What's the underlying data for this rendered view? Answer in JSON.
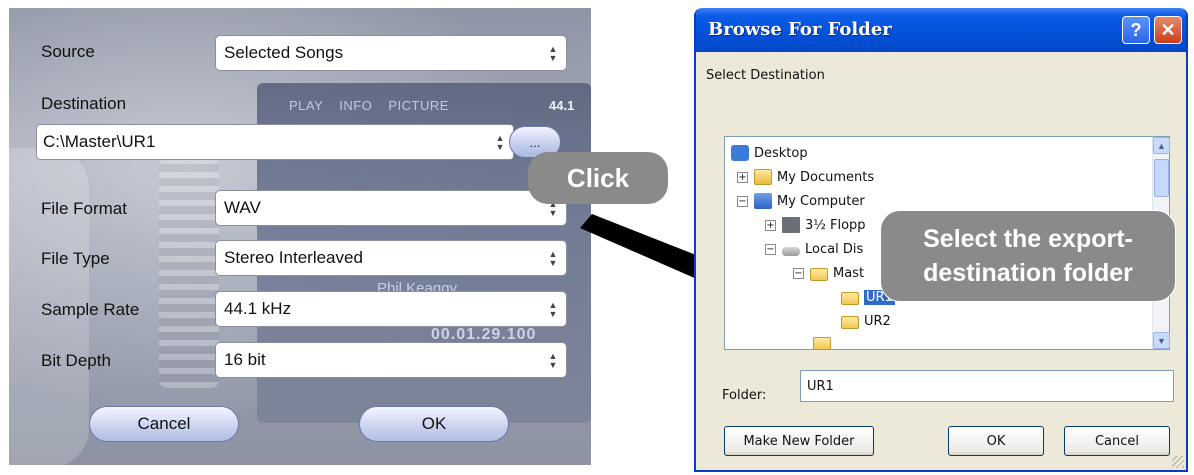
{
  "export_dialog": {
    "source_label": "Source",
    "source_value": "Selected Songs",
    "destination_label": "Destination",
    "destination_value": "C:\\Master\\UR1",
    "browse_label": "...",
    "file_format_label": "File Format",
    "file_format_value": "WAV",
    "file_type_label": "File Type",
    "file_type_value": "Stereo Interleaved",
    "sample_rate_label": "Sample Rate",
    "sample_rate_value": "44.1 kHz",
    "bit_depth_label": "Bit Depth",
    "bit_depth_value": "16 bit",
    "cancel_label": "Cancel",
    "ok_label": "OK",
    "background": {
      "nav_play": "PLAY",
      "nav_info": "INFO",
      "nav_picture": "PICTURE",
      "rate": "44.1",
      "artist": "Phil Keaggy",
      "time": "00.01.29.100"
    }
  },
  "callouts": {
    "click": "Click",
    "select_line1": "Select the export-",
    "select_line2": "destination folder"
  },
  "browse_dialog": {
    "title": "Browse For Folder",
    "help_glyph": "?",
    "close_glyph": "✕",
    "prompt": "Select Destination",
    "tree": {
      "desktop": "Desktop",
      "my_documents": "My Documents",
      "my_computer": "My Computer",
      "floppy": "3½ Flopp",
      "local_disk": "Local Dis",
      "master": "Mast",
      "ur1": "UR1",
      "ur2": "UR2"
    },
    "folder_label": "Folder:",
    "folder_value": "UR1",
    "make_new_folder_label": "Make New Folder",
    "ok_label": "OK",
    "cancel_label": "Cancel"
  },
  "colors": {
    "xp_title": "#0550d8",
    "selection": "#316ac5",
    "callout": "#8a8a8a"
  }
}
